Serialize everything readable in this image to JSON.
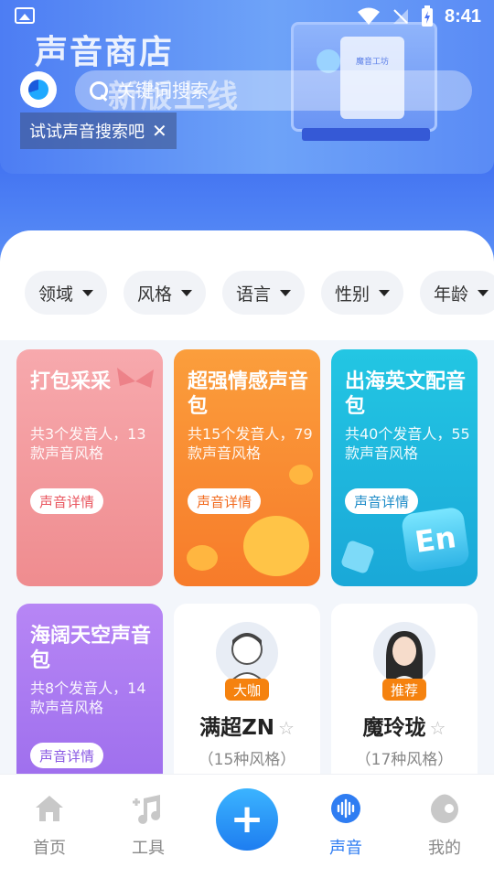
{
  "status_bar": {
    "time": "8:41"
  },
  "banner": {
    "title": "声音商店",
    "subtitle": "新版上线",
    "monitor_text": "魔音工坊"
  },
  "search": {
    "placeholder": "关键词搜索",
    "tooltip": "试试声音搜索吧",
    "tooltip_close": "✕"
  },
  "filters": [
    "领域",
    "风格",
    "语言",
    "性别",
    "年龄"
  ],
  "packs": [
    {
      "title": "打包采采",
      "desc": "共3个发音人，13款声音风格",
      "button": "声音详情"
    },
    {
      "title": "超强情感声音包",
      "desc": "共15个发音人，79款声音风格",
      "button": "声音详情"
    },
    {
      "title": "出海英文配音包",
      "desc": "共40个发音人，55款声音风格",
      "button": "声音详情",
      "tile": "En"
    },
    {
      "title": "海阔天空声音包",
      "desc": "共8个发音人，14款声音风格",
      "button": "声音详情"
    }
  ],
  "voices": [
    {
      "badge": "大咖",
      "name": "满超ZN",
      "styles": "（15种风格）"
    },
    {
      "badge": "推荐",
      "name": "魔玲珑",
      "styles": "（17种风格）"
    }
  ],
  "tabs": [
    {
      "label": "首页",
      "icon": "home-icon"
    },
    {
      "label": "工具",
      "icon": "music-note-icon"
    },
    {
      "label": "声音",
      "icon": "sound-wave-icon",
      "active": true
    },
    {
      "label": "我的",
      "icon": "profile-face-icon"
    }
  ],
  "colors": {
    "accent": "#2f7df2",
    "badge": "#f5820f"
  }
}
